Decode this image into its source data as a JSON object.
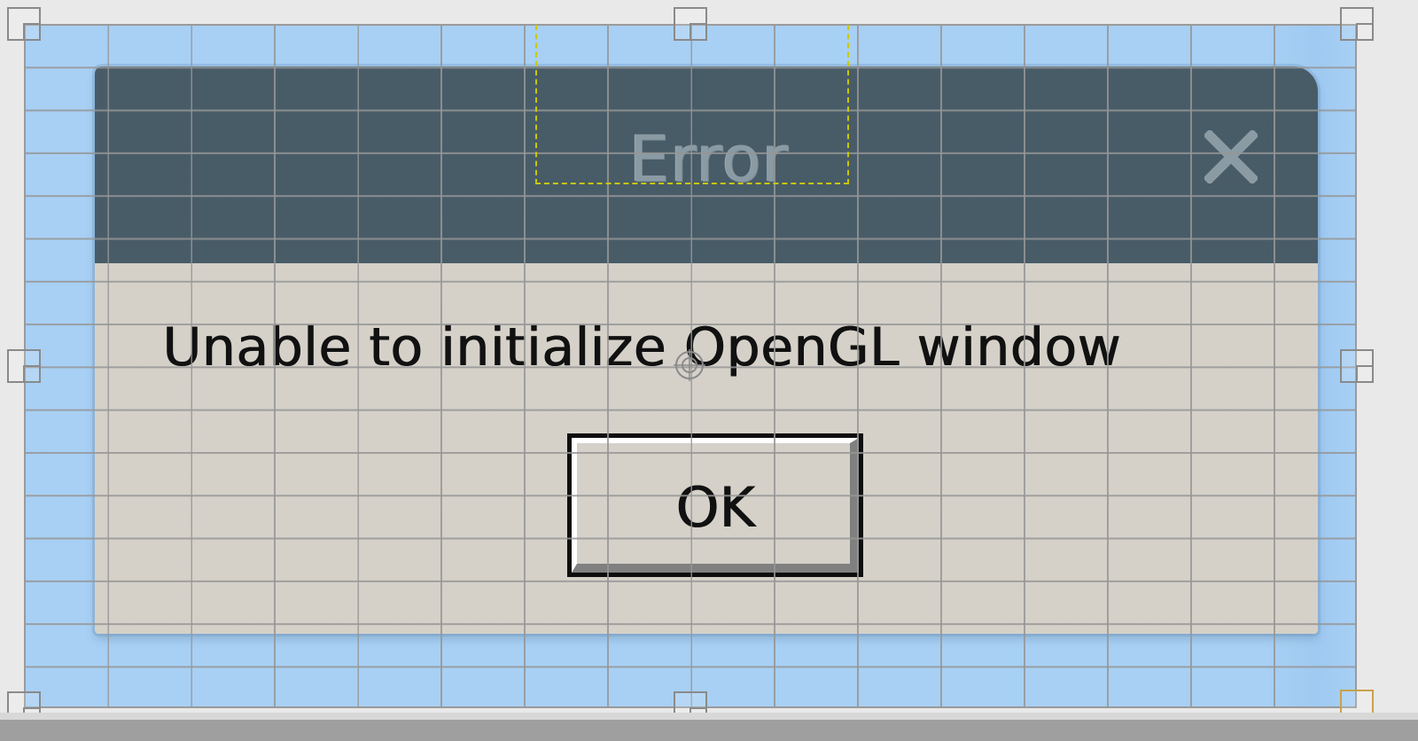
{
  "dialog": {
    "title": "Error",
    "close_icon": "close-icon",
    "message": "Unable to initialize OpenGL window",
    "ok_label": "OK"
  },
  "colors": {
    "canvas_background": "#a8d0f4",
    "titlebar": "#485c68",
    "title_text": "#8a9ba4",
    "dialog_body": "#d5d1c9",
    "grid_lines": "#969696",
    "selection_dash": "#c8c800"
  },
  "icons": {
    "selection_handles": "resize-handle-icon",
    "center": "crosshair-icon"
  }
}
